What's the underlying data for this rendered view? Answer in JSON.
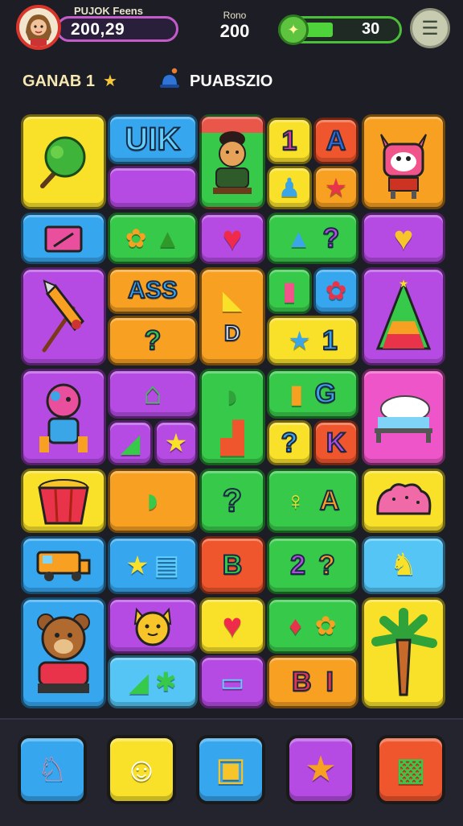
{
  "header": {
    "player_name": "PUJOK Feens",
    "score": "200,29",
    "center_label": "Rono",
    "center_value": "200",
    "energy_value": "30",
    "energy_icon": "leaf-icon",
    "menu_icon": "hamburger-menu-icon"
  },
  "status": {
    "level_label": "GANAB 1",
    "level_star": "★",
    "puzzle_name": "PUABSZIO"
  },
  "board": {
    "text_tiles": {
      "uik": "UIK",
      "one_a": "1",
      "a_char": "A",
      "ask": "ASS",
      "q1": "?",
      "q2": "?",
      "d_char": "D",
      "one_b": "1",
      "c_char": "G",
      "q3": "?",
      "k_char": "K",
      "q4": "?",
      "a2": "A",
      "b_char": "B",
      "q5": "2",
      "q6": "?",
      "q7": "?",
      "b2": "B",
      "i_char": "I"
    }
  },
  "colors": {
    "yellow": "#f9e12a",
    "orange": "#f7a021",
    "blue": "#36a6ef",
    "green": "#37c94a",
    "purple": "#b54be3",
    "pink": "#ee55c8",
    "red": "#f0562d"
  },
  "bottom_bar": {
    "items": [
      "donkey-icon",
      "cat-face-icon",
      "map-icon",
      "star-monster-icon",
      "robot-icon"
    ]
  }
}
